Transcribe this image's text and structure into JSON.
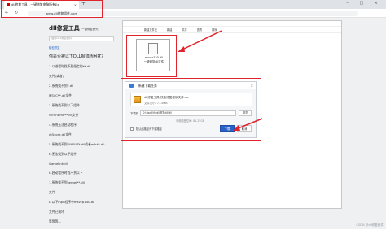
{
  "browser": {
    "tab_title": "dll修复工具 - 一键修复电脑所有Ex",
    "tab_close": "×",
    "new_tab": "+",
    "window_controls": "– □ ×",
    "nav_back": "←",
    "nav_refresh": "↻",
    "url": "www.dll修复组件.com"
  },
  "site": {
    "logo": "dll修复工具",
    "logo_sub": "一键修复缺失",
    "search_placeholder": "搜索DLL修复组件",
    "section_link": "轻松修复",
    "list_title": "你是否被以下DLL报错所困扰?",
    "list_items": [
      "1.以进程时找不到指定的**.dll",
      "文件(或者)",
      "2.系统找不到*.dll",
      "MSVC**.dll文件",
      "3.系统找不到以下组件",
      "vcruntime**.dll文件",
      "4.系统无法启动程序",
      "qt5core.dll文件",
      "5.系统找不到XINPUT*.dll或者mfc**.dll",
      "6.无法找到以下组件",
      "Gamelink.dll",
      "6.启动程序时找不到以下",
      "7.系统找不到kernel**.dll",
      "文件",
      "8.以下lhpd程序中msvcp140.dll",
      "文件已损坏",
      "等等等..."
    ]
  },
  "explorer": {
    "menu": [
      "新建文件夹",
      "新建",
      "共享",
      "查看",
      "排序"
    ],
    "file_name": "msvcr120.dll",
    "file_sub": "一键修复dll文件"
  },
  "dialog": {
    "title": "新建下载任务",
    "close": "×",
    "filename": "dll修复工具-快速修复程序文件.rar",
    "filesize": "文件大小: 77.5MB",
    "path_label": "下载到",
    "path_value": "D:\\fixdll\\fixdll修复dll\\dll",
    "browse": "浏览",
    "free_space": "可用磁盘空间: 81.25GB",
    "default_check_label": "默认此路径为下载路径",
    "download_btn": "下载",
    "cancel_btn": "取消"
  },
  "watermark": "CSDN @dll修复组件"
}
